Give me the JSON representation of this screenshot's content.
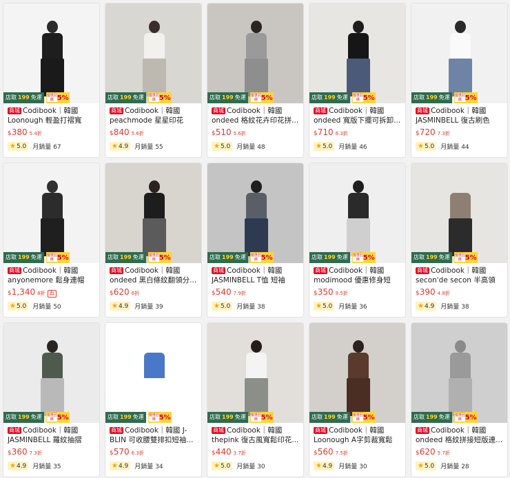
{
  "badges": {
    "store_prefix": "店取",
    "store_amount": "199",
    "store_suffix": "免運",
    "sale_label": "優惠回饋",
    "sale_percent": "5%"
  },
  "tag_label": "商城",
  "currency": "$",
  "sales_label": "月銷量",
  "products": [
    {
      "line1": "Codibook｜韓國",
      "line2": "Loonough 輕盈打褶寬鬆...",
      "price": "380",
      "discount": "5.4折",
      "extra": "",
      "rating": "5.0",
      "sales": "67",
      "colors": {
        "bg": "#f4f4f4",
        "head": "#2b2b2b",
        "torso": "#1e1e1e",
        "legs": "#1a1a1a"
      }
    },
    {
      "line1": "Codibook｜韓國",
      "line2": "peachmode 星星印花寬...",
      "price": "840",
      "discount": "5.6折",
      "extra": "",
      "rating": "4.9",
      "sales": "55",
      "colors": {
        "bg": "#d9d7d2",
        "head": "#3a2e2a",
        "torso": "#f3f1ee",
        "legs": "#bdb8b0"
      }
    },
    {
      "line1": "Codibook｜韓國",
      "line2": "ondeed 格紋花卉印花拼...",
      "price": "510",
      "discount": "5.6折",
      "extra": "",
      "rating": "5.0",
      "sales": "48",
      "colors": {
        "bg": "#c9c6c1",
        "head": "#2a2422",
        "torso": "#9a9a9a",
        "legs": "#8e8e8e"
      }
    },
    {
      "line1": "Codibook｜韓國",
      "line2": "ondeed 寬版下擺可拆卸...",
      "price": "710",
      "discount": "6.3折",
      "extra": "",
      "rating": "5.0",
      "sales": "46",
      "colors": {
        "bg": "#e8e6e2",
        "head": "#1d1d1d",
        "torso": "#161616",
        "legs": "#4a5a78"
      }
    },
    {
      "line1": "Codibook｜韓國",
      "line2": "JASMINBELL 復古刷色喇...",
      "price": "720",
      "discount": "7.3折",
      "extra": "",
      "rating": "5.0",
      "sales": "44",
      "colors": {
        "bg": "#f1f1f1",
        "head": "#2a2a2a",
        "torso": "#fafafa",
        "legs": "#6d84a6"
      }
    },
    {
      "line1": "Codibook｜韓國",
      "line2": "anyonemore 鬆身連帽針...",
      "price": "1,340",
      "discount": "8折",
      "extra": "五",
      "rating": "5.0",
      "sales": "50",
      "colors": {
        "bg": "#f3f3f3",
        "head": "#303030",
        "torso": "#2c2c2c",
        "legs": "#1f1f1f"
      }
    },
    {
      "line1": "Codibook｜韓國",
      "line2": "ondeed 黑白條紋翻領分...",
      "price": "620",
      "discount": "6折",
      "extra": "",
      "rating": "4.9",
      "sales": "39",
      "colors": {
        "bg": "#d8d4ce",
        "head": "#2a2320",
        "torso": "#1d1d1d",
        "legs": "#5b5b5b"
      }
    },
    {
      "line1": "Codibook｜韓國",
      "line2": "JASMINBELL T恤 短袖上...",
      "price": "540",
      "discount": "7.9折",
      "extra": "",
      "rating": "5.0",
      "sales": "38",
      "colors": {
        "bg": "#c4c4c4",
        "head": "#1e1e1e",
        "torso": "#5a5e66",
        "legs": "#2e3a52"
      }
    },
    {
      "line1": "Codibook｜韓國",
      "line2": "modimood 優惠修身短袖...",
      "price": "350",
      "discount": "9.5折",
      "extra": "",
      "rating": "5.0",
      "sales": "36",
      "colors": {
        "bg": "#efefef",
        "head": "#1f1f1f",
        "torso": "#2a2a2a",
        "legs": "#cfcfcf"
      }
    },
    {
      "line1": "Codibook｜韓國",
      "line2": "secon'de secon 半高領短...",
      "price": "390",
      "discount": "4.8折",
      "extra": "",
      "rating": "4.9",
      "sales": "38",
      "colors": {
        "bg": "#e7e5e1",
        "head": "#e7e5e1",
        "torso": "#8f7f73",
        "legs": "#2b2b2b"
      }
    },
    {
      "line1": "Codibook｜韓國",
      "line2": "JASMINBELL 羅紋抽摺短...",
      "price": "360",
      "discount": "7.3折",
      "extra": "",
      "rating": "4.9",
      "sales": "35",
      "colors": {
        "bg": "#ebebeb",
        "head": "#2a2420",
        "torso": "#4f5a4f",
        "legs": "#b9b9b9"
      }
    },
    {
      "line1": "Codibook｜韓國 J-",
      "line2": "BLIN 可收腰雙排扣短袖...",
      "price": "570",
      "discount": "6.3折",
      "extra": "",
      "rating": "4.9",
      "sales": "34",
      "colors": {
        "bg": "#ffffff",
        "head": "#ffffff",
        "torso": "#4a78c8",
        "legs": "#ffffff"
      }
    },
    {
      "line1": "Codibook｜韓國",
      "line2": "thepink 復古風寬鬆印花...",
      "price": "440",
      "discount": "3.7折",
      "extra": "",
      "rating": "5.0",
      "sales": "30",
      "colors": {
        "bg": "#e2dfda",
        "head": "#231d1b",
        "torso": "#f4f4f4",
        "legs": "#8a8f8a"
      }
    },
    {
      "line1": "Codibook｜韓國",
      "line2": "Loonough A字剪裁寬鬆休...",
      "price": "560",
      "discount": "7.5折",
      "extra": "",
      "rating": "4.9",
      "sales": "30",
      "colors": {
        "bg": "#d3cfca",
        "head": "#2a2220",
        "torso": "#5b3a2e",
        "legs": "#4a2e24"
      }
    },
    {
      "line1": "Codibook｜韓國",
      "line2": "ondeed 格紋拼接短版連...",
      "price": "620",
      "discount": "5.7折",
      "extra": "",
      "rating": "5.0",
      "sales": "28",
      "colors": {
        "bg": "#cfcfcf",
        "head": "#8a8a8a",
        "torso": "#9a9a9a",
        "legs": "#b0b0b0"
      }
    }
  ]
}
